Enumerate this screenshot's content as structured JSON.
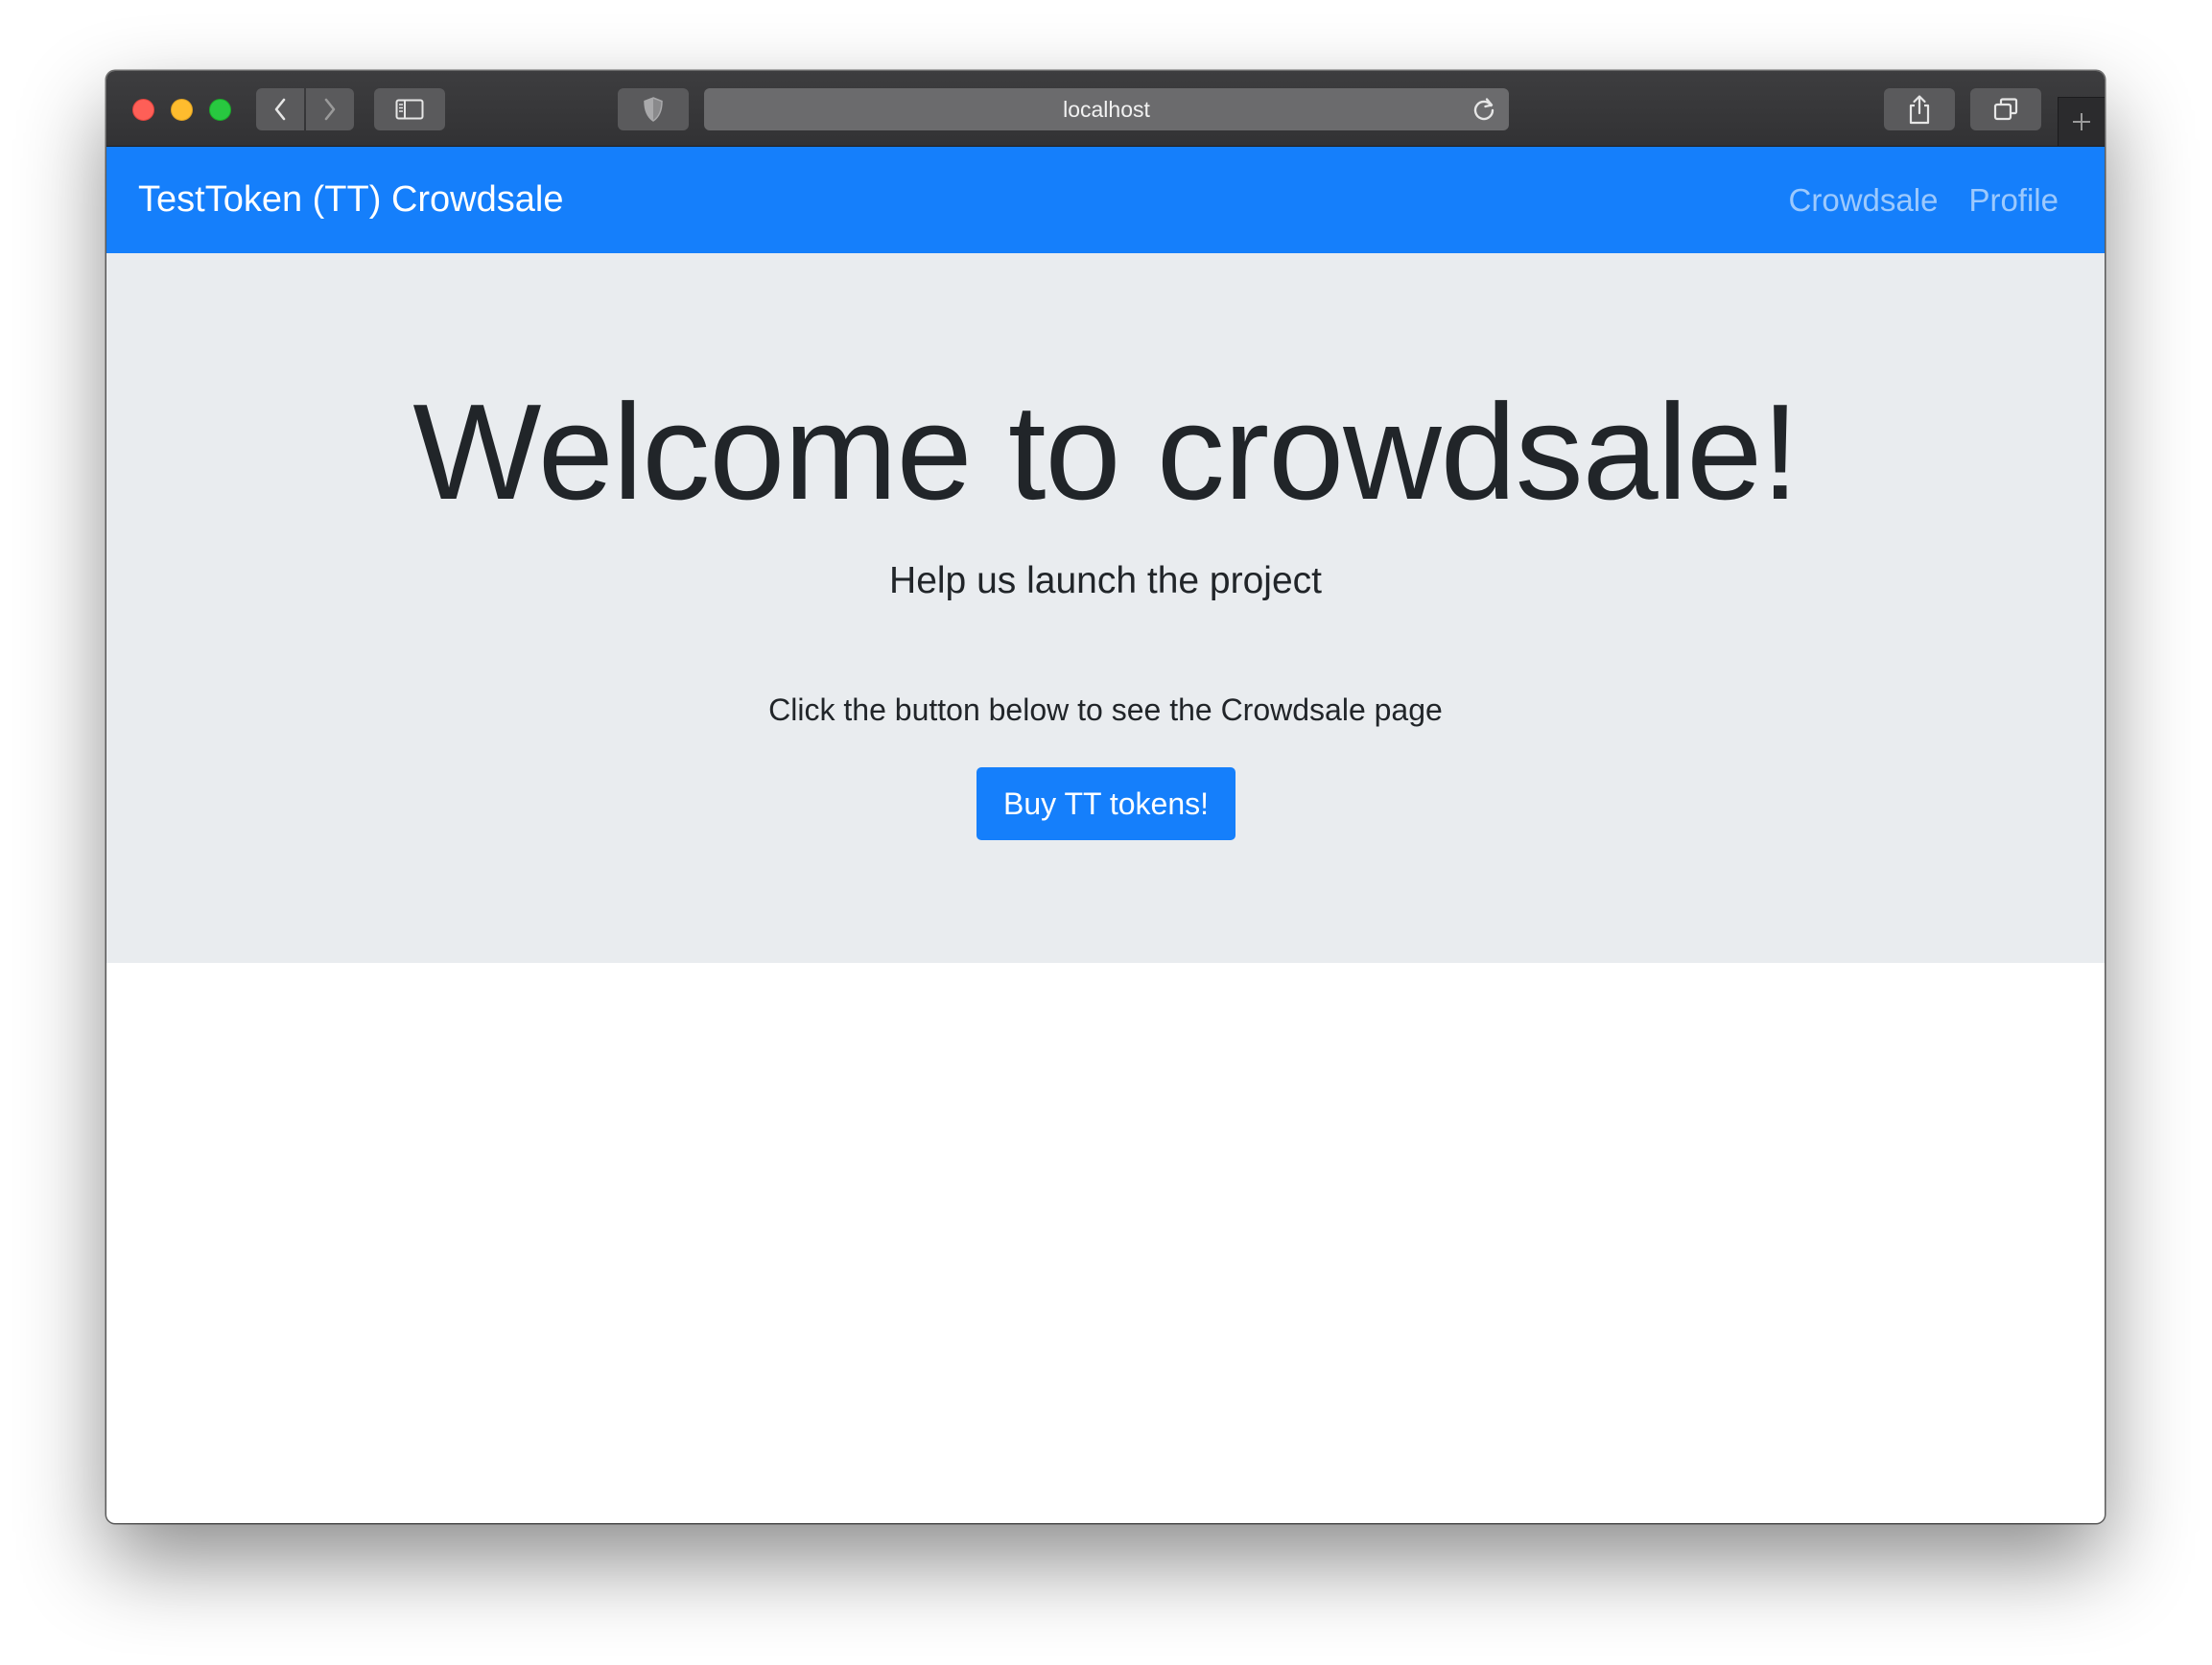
{
  "browser": {
    "address": "localhost",
    "icons": {
      "back": "chevron-left-icon",
      "forward": "chevron-right-icon",
      "sidebar": "sidebar-icon",
      "privacy": "shield-icon",
      "reload": "reload-icon",
      "share": "share-icon",
      "tabs": "tabs-overview-icon",
      "new_tab": "plus-icon"
    }
  },
  "navbar": {
    "brand": "TestToken (TT) Crowdsale",
    "links": [
      {
        "label": "Crowdsale"
      },
      {
        "label": "Profile"
      }
    ],
    "color": "#157ffb"
  },
  "jumbotron": {
    "title": "Welcome to crowdsale!",
    "subtitle": "Help us launch the project",
    "text": "Click the button below to see the Crowdsale page",
    "button_label": "Buy TT tokens!",
    "background": "#e9ecef"
  }
}
